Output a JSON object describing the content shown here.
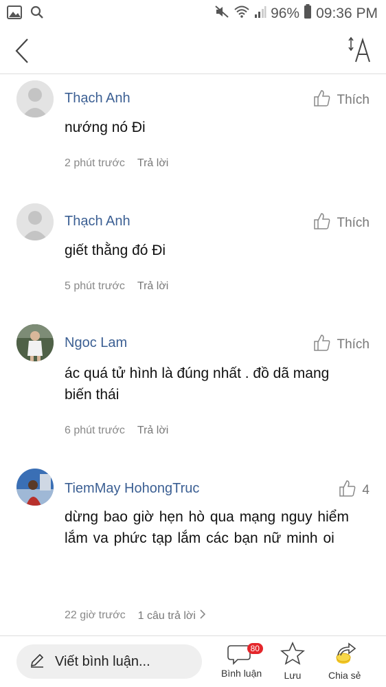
{
  "status_bar": {
    "battery": "96%",
    "time": "09:36 PM"
  },
  "header": {
    "icons": [
      "back-arrow-icon",
      "font-size-icon"
    ]
  },
  "comments": [
    {
      "author": "Thạch Anh",
      "text": "nướng nó Đi",
      "time": "2 phút trước",
      "reply_label": "Trả lời",
      "like_label": "Thích"
    },
    {
      "author": "Thạch Anh",
      "text": "giết thằng đó Đi",
      "time": "5 phút trước",
      "reply_label": "Trả lời",
      "like_label": "Thích"
    },
    {
      "author": "Ngoc Lam",
      "text": "ác quá tử hình là đúng nhất . đồ dã mang biến thái",
      "time": "6 phút trước",
      "reply_label": "Trả lời",
      "like_label": "Thích"
    },
    {
      "author": "TiemMay HohongTruc",
      "text": "dừng  bao giờ  hẹn  hò  qua  mạng  nguy hiểm lắm va phức tạp lắm  các bạn nữ minh  oi",
      "time": "22 giờ trước",
      "reply_label": "1 câu trả lời",
      "like_label": "4"
    }
  ],
  "bottom_bar": {
    "write_placeholder": "Viết bình luận...",
    "comments_label": "Bình luận",
    "comments_count": "80",
    "save_label": "Lưu",
    "share_label": "Chia sẻ"
  }
}
